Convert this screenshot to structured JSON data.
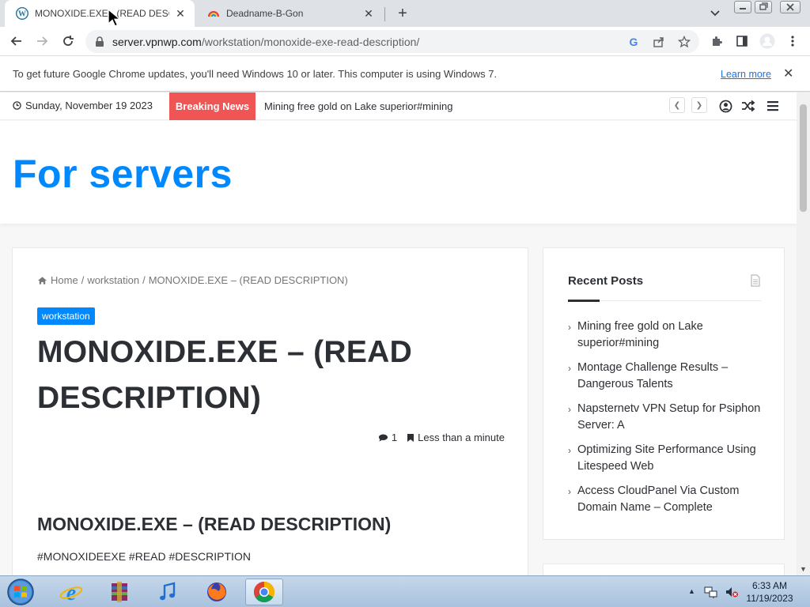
{
  "browser": {
    "tabs": [
      {
        "title": "MONOXIDE.EXE - (READ DESCRIPTION)",
        "active": true
      },
      {
        "title": "Deadname-B-Gon",
        "active": false
      }
    ],
    "url_host": "server.vpnwp.com",
    "url_path": "/workstation/monoxide-exe-read-description/"
  },
  "infobar": {
    "message": "To get future Google Chrome updates, you'll need Windows 10 or later. This computer is using Windows 7.",
    "link": "Learn more"
  },
  "topnav": {
    "date": "Sunday, November 19 2023",
    "breaking_label": "Breaking News",
    "ticker": "Mining free gold on Lake superior#mining"
  },
  "site": {
    "title": "For servers"
  },
  "article": {
    "breadcrumb": {
      "home": "Home",
      "sep1": "/",
      "category": "workstation",
      "sep2": "/",
      "current": "MONOXIDE.EXE – (READ DESCRIPTION)"
    },
    "category_badge": "workstation",
    "title": "MONOXIDE.EXE – (READ DESCRIPTION)",
    "comments": "1",
    "read_time": "Less than a minute",
    "heading": "MONOXIDE.EXE – (READ DESCRIPTION)",
    "tags": "#MONOXIDEEXE #READ #DESCRIPTION"
  },
  "sidebar": {
    "widget_title": "Recent Posts",
    "recent_posts": [
      "Mining free gold on Lake superior#mining",
      "Montage Challenge Results – Dangerous Talents",
      "Napsternetv VPN Setup for Psiphon Server: A",
      "Optimizing Site Performance Using Litespeed Web",
      "Access CloudPanel Via Custom Domain Name – Complete"
    ]
  },
  "taskbar": {
    "clock_time": "6:33 AM",
    "clock_date": "11/19/2023"
  },
  "colors": {
    "accent": "#0088ff",
    "breaking": "#f05555",
    "link": "#1a73e8"
  }
}
